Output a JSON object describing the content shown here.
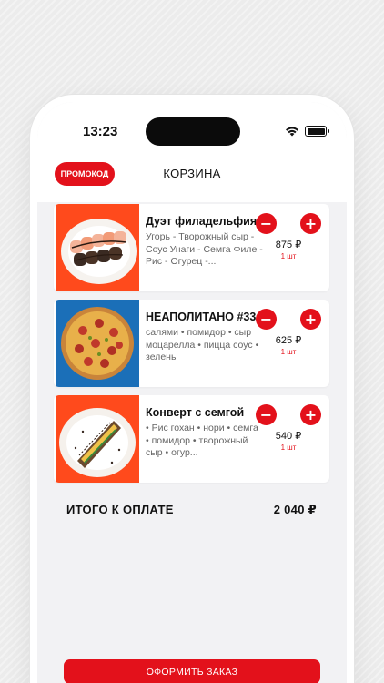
{
  "status_bar": {
    "time": "13:23"
  },
  "header": {
    "promo_label": "ПРОМОКОД",
    "title": "КОРЗИНА"
  },
  "cart_items": [
    {
      "name": "Дуэт филадельфия",
      "description": "Угорь - Творожный сыр - Соус Унаги - Семга Филе - Рис - Огурец -...",
      "price": "875 ₽",
      "quantity": "1 шт",
      "thumb_bg": "#ff4a1c"
    },
    {
      "name": "НЕАПОЛИТАНО #33",
      "description": "салями • помидор • сыр моцарелла • пицца соус • зелень",
      "price": "625 ₽",
      "quantity": "1 шт",
      "thumb_bg": "#1b6fb8"
    },
    {
      "name": "Конверт с семгой",
      "description": "• Рис гохан • нори • семга • помидор • творожный сыр • огур...",
      "price": "540 ₽",
      "quantity": "1 шт",
      "thumb_bg": "#ff4a1c"
    }
  ],
  "controls": {
    "minus": "−",
    "plus": "+"
  },
  "total": {
    "label": "ИТОГО К ОПЛАТЕ",
    "value": "2 040 ₽"
  },
  "checkout": {
    "label": "ОФОРМИТЬ ЗАКАЗ"
  },
  "colors": {
    "accent": "#e3111b",
    "background": "#f2f2f4"
  },
  "icons": [
    "wifi-icon",
    "battery-icon",
    "minus-icon",
    "plus-icon"
  ]
}
